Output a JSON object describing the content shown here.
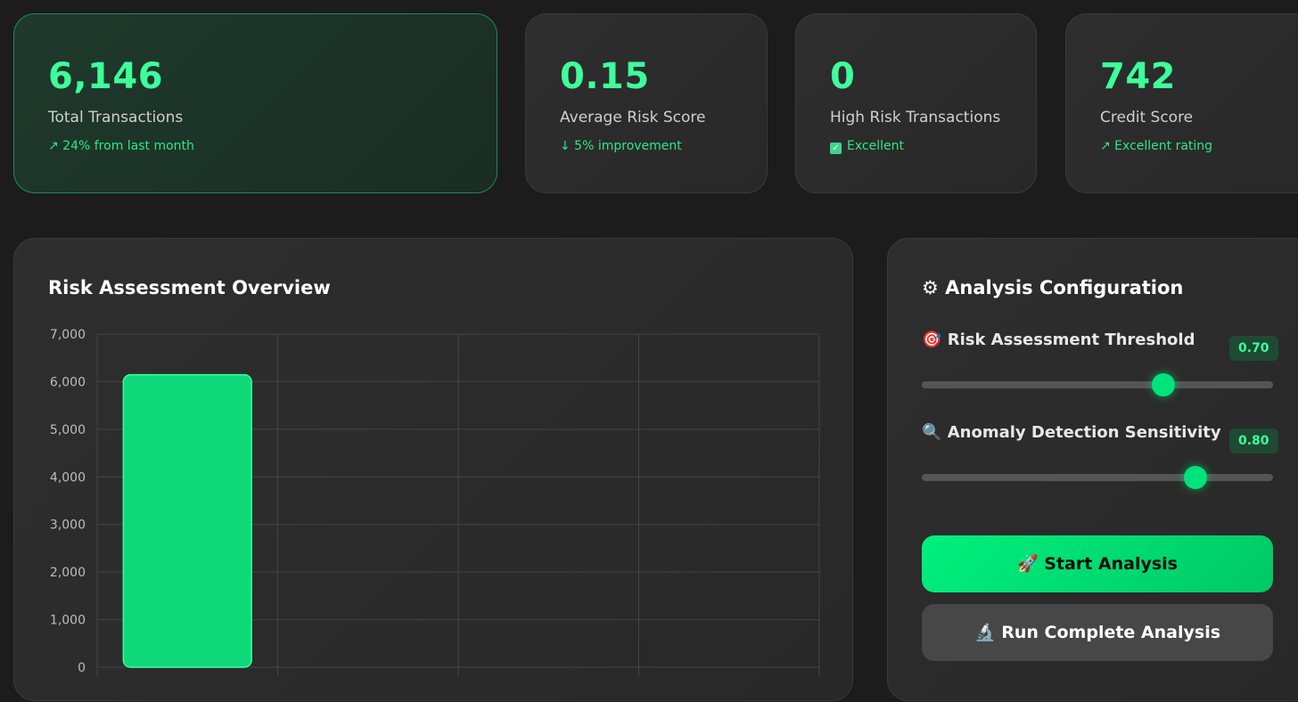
{
  "stats": [
    {
      "value": "6,146",
      "label": "Total Transactions",
      "note": "↗ 24% from last month"
    },
    {
      "value": "0.15",
      "label": "Average Risk Score",
      "note": "↓ 5% improvement"
    },
    {
      "value": "0",
      "label": "High Risk Transactions",
      "note": "Excellent"
    },
    {
      "value": "742",
      "label": "Credit Score",
      "note": "↗ Excellent rating"
    }
  ],
  "chart_panel": {
    "title": "Risk Assessment Overview"
  },
  "chart_data": {
    "type": "bar",
    "categories": [
      "",
      "",
      "",
      ""
    ],
    "values": [
      6146,
      0,
      0,
      0
    ],
    "ylim": [
      0,
      7000
    ],
    "yticks": [
      "0",
      "1,000",
      "2,000",
      "3,000",
      "4,000",
      "5,000",
      "6,000",
      "7,000"
    ],
    "grid": true,
    "bar_color": "#0fd87a"
  },
  "config": {
    "title": "⚙ Analysis Configuration",
    "sliders": [
      {
        "label": "Risk Assessment Threshold",
        "icon": "🎯",
        "value": "0.70",
        "fraction": 0.7
      },
      {
        "label": "Anomaly Detection Sensitivity",
        "icon": "🔍",
        "value": "0.80",
        "fraction": 0.8
      }
    ],
    "start_button": "🚀 Start Analysis",
    "run_button": "🔬 Run Complete Analysis"
  },
  "colors": {
    "accent": "#3dff9a",
    "background": "#1c1c1c",
    "card": "#2b2b2b"
  }
}
